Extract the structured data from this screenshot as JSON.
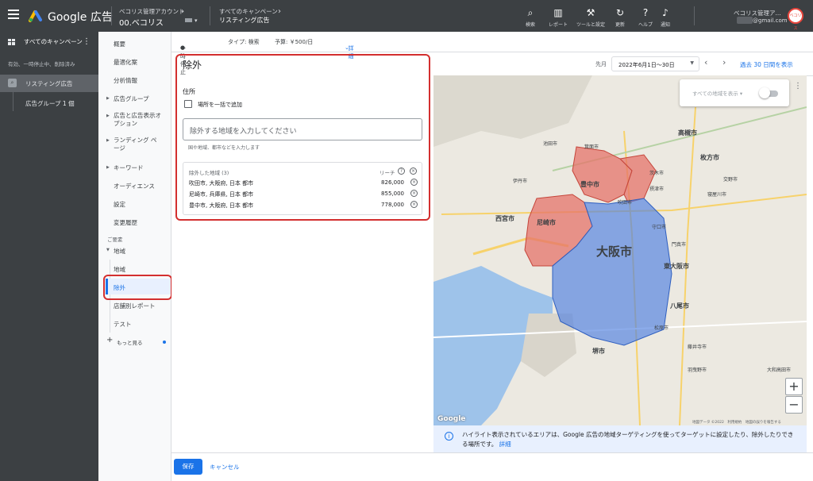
{
  "header": {
    "brand": "Google 広告",
    "account_label": "ベコリス管理アカウント",
    "account_name": "00.ベコリス",
    "campaign_label": "すべてのキャンペーン",
    "campaign_name": "リスティング広告",
    "tools": [
      {
        "icon": "search-icon",
        "label": "検索"
      },
      {
        "icon": "reports-icon",
        "label": "レポート"
      },
      {
        "icon": "wrench-icon",
        "label": "ツールと設定"
      },
      {
        "icon": "refresh-icon",
        "label": "更新"
      },
      {
        "icon": "help-icon",
        "label": "ヘルプ"
      },
      {
        "icon": "bell-icon",
        "label": "通知"
      }
    ],
    "user_name": "ベコリス管理ア...",
    "user_email": "@gmail.com",
    "avatar_text": "ベコリス"
  },
  "nav1": {
    "title": "すべてのキャンペーン",
    "filter": "有効、一時停止中、削除済み",
    "selected": "リスティング広告",
    "sub": "広告グループ 1 個"
  },
  "nav2": {
    "items": [
      "概要",
      "最適化案",
      "分析情報",
      "広告グループ",
      "広告と広告表示オプション",
      "ランディング ページ",
      "キーワード",
      "オーディエンス",
      "設定",
      "変更履歴"
    ],
    "group_label": "ご要素",
    "group_title": "地域",
    "group_items": [
      "地域",
      "除外",
      "店舗別レポート",
      "テスト"
    ],
    "more": "もっと見る"
  },
  "status_bar": {
    "status": "一時停止",
    "type": "タイプ: 検索",
    "budget": "予算: ￥500/日",
    "details": "詳細"
  },
  "panel": {
    "title": "除外",
    "address_label": "住所",
    "bulk_add": "場所を一括で追加",
    "input_placeholder": "除外する地域を入力してください",
    "hint": "国や地域、都市などを入力します",
    "list_header": "除外した地域 (3)",
    "reach_header": "リーチ",
    "rows": [
      {
        "name": "吹田市, 大阪府, 日本 都市",
        "reach": "826,000"
      },
      {
        "name": "尼崎市, 兵庫県, 日本 都市",
        "reach": "855,000"
      },
      {
        "name": "豊中市, 大阪府, 日本 都市",
        "reach": "778,000"
      }
    ]
  },
  "date": {
    "label": "先月",
    "range": "2022年6月1日〜30日",
    "last30": "過去 30 日間を表示"
  },
  "map": {
    "toggle_label": "すべての地域を表示",
    "google": "Google",
    "attribution": "地図データ ©2022　利用規約　地図の誤りを報告する",
    "city_labels": [
      "大阪市",
      "豊中市",
      "尼崎市",
      "吹田市",
      "西宮市",
      "東大阪市",
      "八尾市",
      "堺市",
      "高槻市",
      "枚方市",
      "寝屋川市",
      "交野市",
      "箕面市",
      "池田市",
      "守口市",
      "茨木市",
      "摂津市",
      "伊丹市",
      "門真市",
      "松原市",
      "藤井寺市",
      "羽曳野市",
      "大和高田市"
    ],
    "included_color": "#4f7fe0",
    "excluded_color": "#e5736a"
  },
  "notice": {
    "text": "ハイライト表示されているエリアは、Google 広告の地域ターゲティングを使ってターゲットに設定したり、除外したりできる場所です。",
    "link": "詳細"
  },
  "footer": {
    "save": "保存",
    "cancel": "キャンセル"
  }
}
